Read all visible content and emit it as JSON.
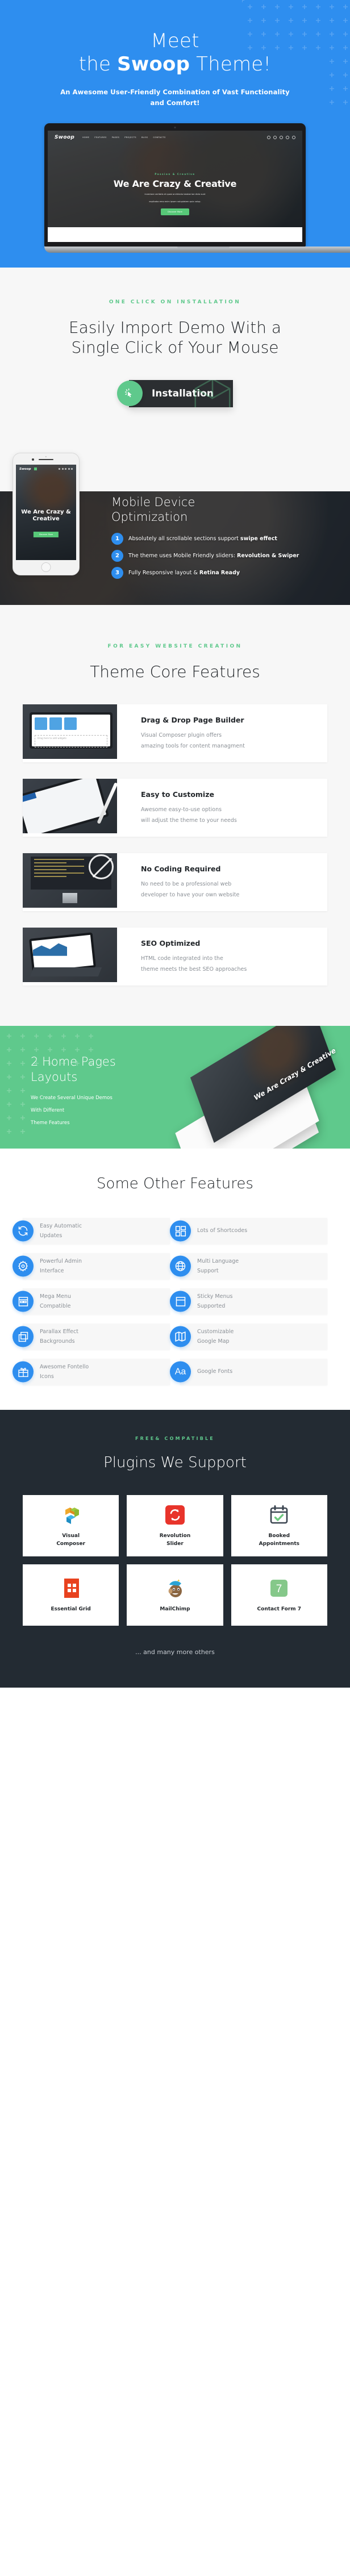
{
  "hero": {
    "title_line1": "Meet",
    "title_line2_pre": "the ",
    "title_line2_strong": "Swoop",
    "title_line2_post": " Theme!",
    "subtitle": "An Awesome User-Friendly Combination of Vast Functionality and Comfort!",
    "bg_color": "#2e8eef",
    "mockup": {
      "logo": "Swoop",
      "menu": [
        "HOME",
        "FEATURES",
        "PAGES",
        "PROJECTS",
        "BLOG",
        "CONTACTS"
      ],
      "eyebrow": "Passion & Creative",
      "headline": "We Are Crazy & Creative",
      "paragraph_line1": "inventore veritatis et quasi architecto beatae lae dicta sunt",
      "paragraph_line2": "explicabo emo enim ipsam voluptatem quia volup.",
      "button": "Discover More"
    }
  },
  "installation": {
    "eyebrow": "ONE CLICK ON INSTALLATION",
    "title_line1": "Easily Import Demo With a",
    "title_line2": "Single Click of Your Mouse",
    "button_label": "Installation",
    "button_icon": "cursor-click-icon",
    "accent": "#5fc98c"
  },
  "mobile": {
    "title_line1": "Mobile Device",
    "title_line2": "Optimization",
    "phone": {
      "logo": "Swoop",
      "headline": "We Are Crazy & Creative",
      "button": "Discover More"
    },
    "items": [
      {
        "num": "1",
        "text_pre": "Absolutely all scrollable sections support ",
        "text_bold": "swipe effect",
        "text_post": ""
      },
      {
        "num": "2",
        "text_pre": "The theme uses Mobile Friendly sliders: ",
        "text_bold": "Revolution & Swiper",
        "text_post": ""
      },
      {
        "num": "3",
        "text_pre": "Fully Responsive layout & ",
        "text_bold": "Retina Ready",
        "text_post": ""
      }
    ]
  },
  "core": {
    "eyebrow": "FOR EASY WEBSITE CREATION",
    "title": "Theme Core Features",
    "features": [
      {
        "title": "Drag & Drop Page Builder",
        "desc_line1": "Visual Composer plugin offers",
        "desc_line2": "amazing tools for content managment",
        "art": "vc"
      },
      {
        "title": "Easy to Customize",
        "desc_line1": "Awesome easy-to-use options",
        "desc_line2": "will adjust the theme to your needs",
        "art": "tablet"
      },
      {
        "title": "No Coding Required",
        "desc_line1": "No need to be a professional web",
        "desc_line2": "developer to have your own website",
        "art": "code"
      },
      {
        "title": "SEO Optimized",
        "desc_line1": "HTML code integrated into the",
        "desc_line2": "theme meets the best SEO approaches",
        "art": "seo"
      }
    ]
  },
  "homepages": {
    "title_line1": "2 Home Pages",
    "title_line2": "Layouts",
    "desc_line1": "We Create Several Unique Demos",
    "desc_line2": "With Different",
    "desc_line3": "Theme Features",
    "mock_label": "We Are Crazy & Creative",
    "bg_color": "#5fc98c"
  },
  "other": {
    "title": "Some Other Features",
    "accent": "#2e8eef",
    "items": [
      {
        "label_line1": "Easy Automatic",
        "label_line2": "Updates",
        "icon": "refresh-icon"
      },
      {
        "label_line1": "Lots of Shortcodes",
        "label_line2": "",
        "icon": "grid-blocks-icon"
      },
      {
        "label_line1": "Powerful Admin",
        "label_line2": "Interface",
        "icon": "gear-icon"
      },
      {
        "label_line1": "Multi Language",
        "label_line2": "Support",
        "icon": "globe-icon"
      },
      {
        "label_line1": "Mega Menu",
        "label_line2": "Compatible",
        "icon": "menu-panel-icon"
      },
      {
        "label_line1": "Sticky Menus",
        "label_line2": "Supported",
        "icon": "window-icon"
      },
      {
        "label_line1": "Parallax Effect",
        "label_line2": "Backgrounds",
        "icon": "layers-icon"
      },
      {
        "label_line1": "Customizable",
        "label_line2": "Google Map",
        "icon": "map-icon"
      },
      {
        "label_line1": "Awesome Fontello",
        "label_line2": "Icons",
        "icon": "gift-icon"
      },
      {
        "label_line1": "Google Fonts",
        "label_line2": "",
        "icon": "typography-aa-icon"
      }
    ]
  },
  "plugins": {
    "eyebrow": "FREE& COMPATIBLE",
    "title": "Plugins We Support",
    "footer_note": "... and many more others",
    "items": [
      {
        "name_line1": "Visual",
        "name_line2": "Composer",
        "icon": "visual-composer-logo"
      },
      {
        "name_line1": "Revolution",
        "name_line2": "Slider",
        "icon": "revolution-slider-logo"
      },
      {
        "name_line1": "Booked",
        "name_line2": "Appointments",
        "icon": "booked-calendar-logo"
      },
      {
        "name_line1": "Essential Grid",
        "name_line2": "",
        "icon": "essential-grid-logo"
      },
      {
        "name_line1": "MailChimp",
        "name_line2": "",
        "icon": "mailchimp-logo"
      },
      {
        "name_line1": "Contact Form 7",
        "name_line2": "",
        "icon": "contact-form-7-logo"
      }
    ]
  }
}
